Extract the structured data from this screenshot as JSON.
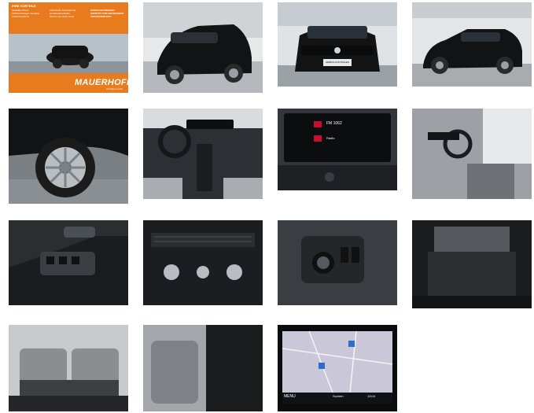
{
  "gallery": {
    "photos": [
      {
        "id": "exterior-dealer-promo"
      },
      {
        "id": "rear-three-quarter"
      },
      {
        "id": "front-view"
      },
      {
        "id": "side-profile"
      },
      {
        "id": "wheel-detail"
      },
      {
        "id": "dashboard-cockpit"
      },
      {
        "id": "infotainment-screen"
      },
      {
        "id": "driver-door-interior"
      },
      {
        "id": "door-window-switches"
      },
      {
        "id": "climate-controls"
      },
      {
        "id": "light-switch-panel"
      },
      {
        "id": "trunk-cargo"
      },
      {
        "id": "rear-seats"
      },
      {
        "id": "front-seat-side"
      },
      {
        "id": "navigation-map"
      }
    ],
    "promo": {
      "vorteile_heading": "IHRE VORTEILE",
      "left_items": [
        "Qualitäts-Check",
        "Gebrauchtwagen-Garantie",
        "Inzahlungnahme"
      ],
      "right_items": [
        "Individuelle Finanzierung",
        "Großkundenrabatte",
        "Service aus einer Hand"
      ],
      "ribbon_lines": [
        "GEBRAUCHTWAGEN",
        "GEPRÜFT UND ZERTIFIZIERT",
        "VON MAUERHOFF"
      ],
      "brand": "MAUERHOFF",
      "brand_sub": "wir lieben Autos"
    },
    "plate_text": "GEBRAUCHTWAGEN",
    "infotainment": {
      "station": "FM 1062",
      "radio_label": "Radio"
    },
    "nav": {
      "menu_label": "MENU",
      "search_label": "Suchen",
      "time": "13:04"
    }
  },
  "colors": {
    "orange": "#e87b1e",
    "car_black": "#111315",
    "interior_grey": "#9a9c9e",
    "showroom": "#d9dde2"
  }
}
